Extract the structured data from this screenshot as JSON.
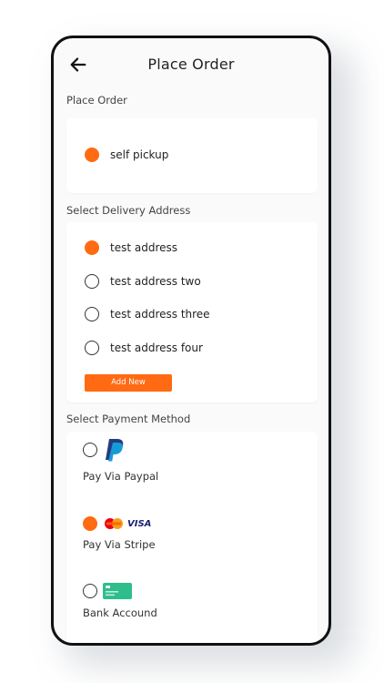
{
  "header": {
    "title": "Place Order",
    "back_icon": "arrow-left-icon"
  },
  "pickup_section": {
    "label": "Place Order",
    "option": {
      "label": "self pickup",
      "selected": true
    }
  },
  "address_section": {
    "label": "Select Delivery Address",
    "options": [
      {
        "label": "test address",
        "selected": true
      },
      {
        "label": "test address two",
        "selected": false
      },
      {
        "label": "test address three",
        "selected": false
      },
      {
        "label": "test address four",
        "selected": false
      }
    ],
    "add_button": "Add New"
  },
  "payment_section": {
    "label": "Select Payment Method",
    "methods": [
      {
        "label": "Pay Via Paypal",
        "selected": false,
        "icon": "paypal-logo"
      },
      {
        "label": "Pay Via Stripe",
        "selected": true,
        "icon": "mastercard-visa-logo",
        "logo_text": "VISA"
      },
      {
        "label": "Bank Accound",
        "selected": false,
        "icon": "bank-card-icon"
      }
    ]
  },
  "colors": {
    "accent": "#ff6a13",
    "background": "#fafafa",
    "card": "#ffffff"
  }
}
